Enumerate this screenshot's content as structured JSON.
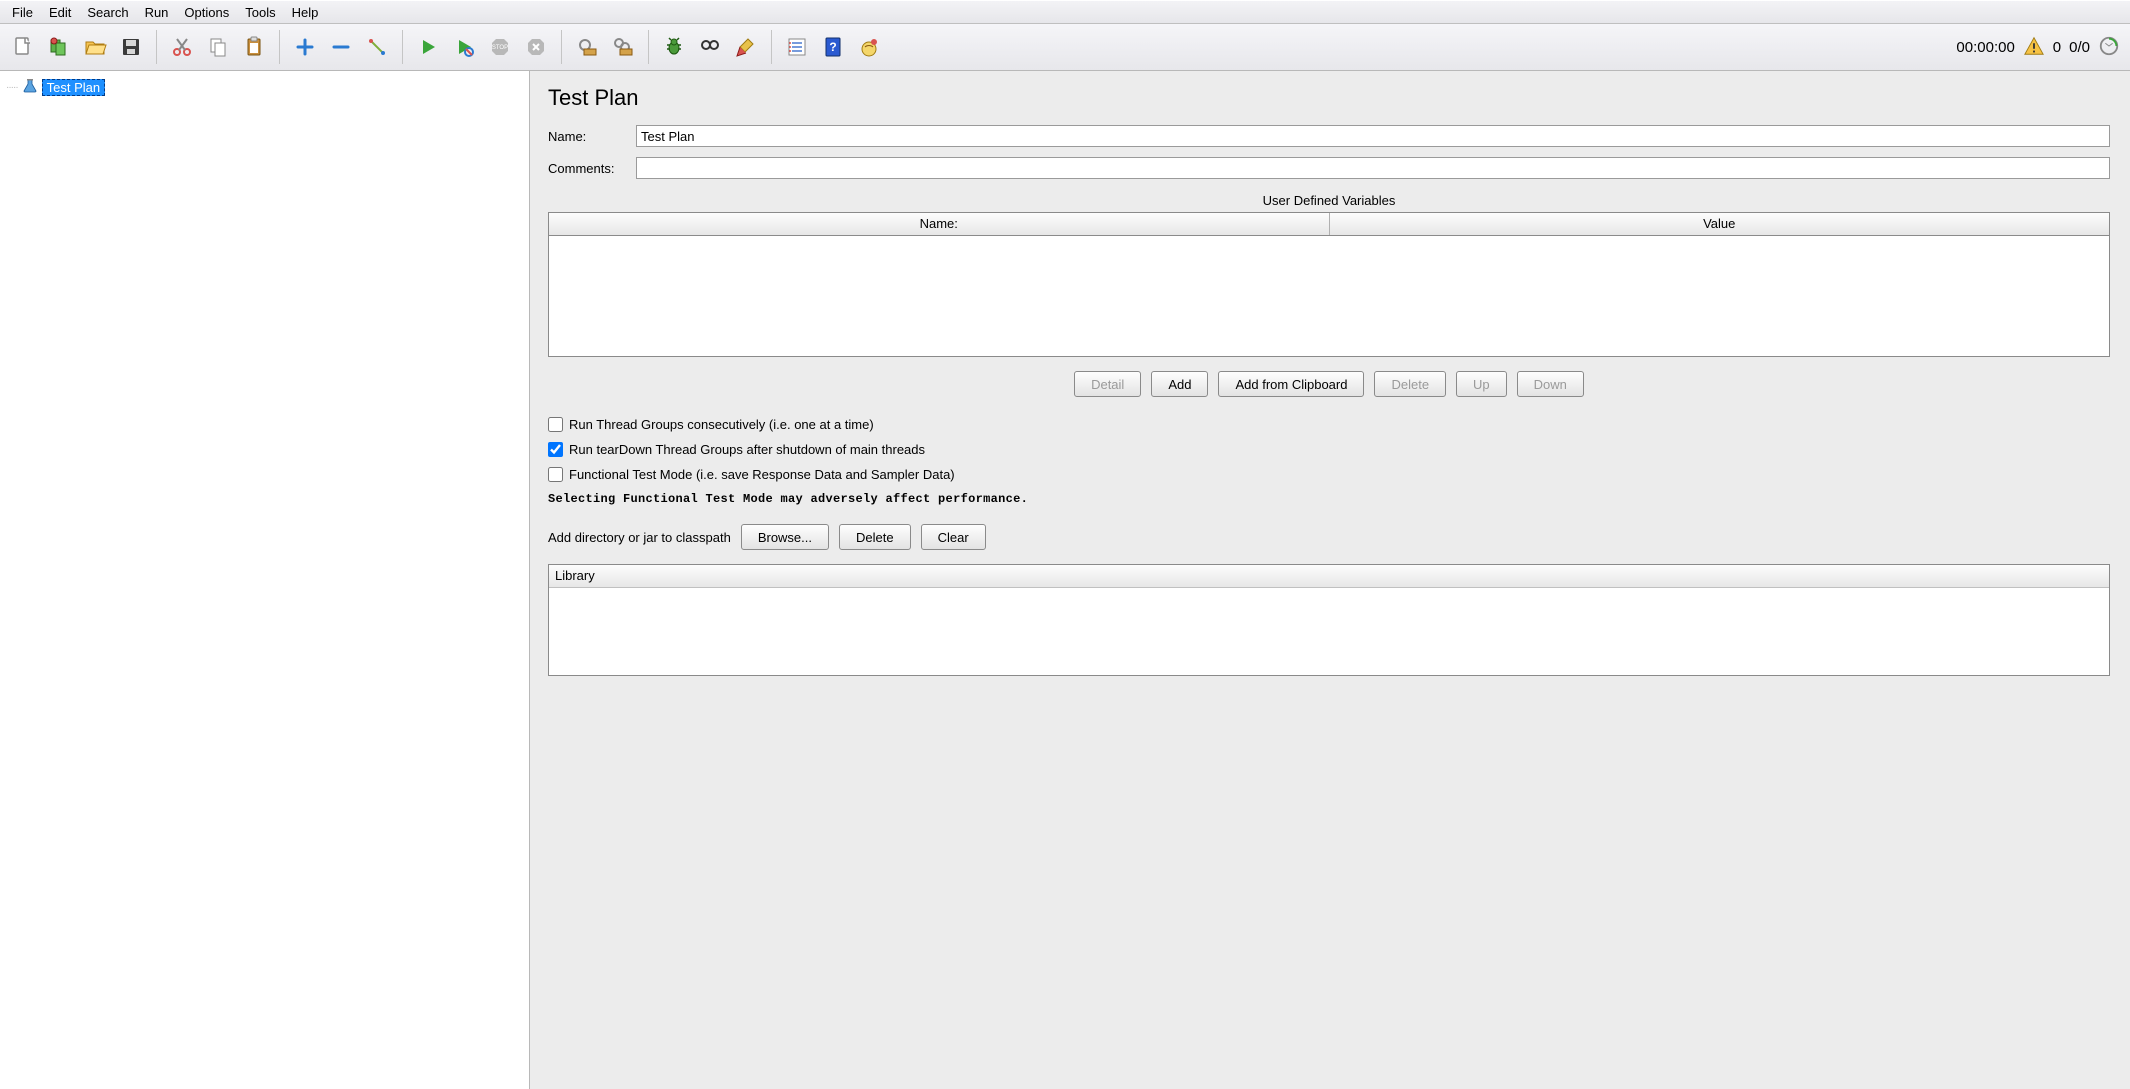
{
  "menu": {
    "file": "File",
    "edit": "Edit",
    "search": "Search",
    "run": "Run",
    "options": "Options",
    "tools": "Tools",
    "help": "Help"
  },
  "toolbar_icons": {
    "new": "new-file-icon",
    "templates": "templates-icon",
    "open": "open-icon",
    "save": "save-icon",
    "cut": "cut-icon",
    "copy": "copy-icon",
    "paste": "paste-icon",
    "expand": "plus-icon",
    "collapse": "minus-icon",
    "toggle": "toggle-icon",
    "start": "start-icon",
    "start_no_pause": "start-no-pause-icon",
    "stop": "stop-icon",
    "shutdown": "shutdown-icon",
    "clear": "clear-icon",
    "clear_all": "clear-all-icon",
    "debug": "debug-icon",
    "search_tool": "search-tool-icon",
    "broom": "broom-icon",
    "func_helper": "function-helper-icon",
    "help_doc": "help-icon",
    "whats_this": "whats-this-icon"
  },
  "status": {
    "elapsed": "00:00:00",
    "warnings": "0",
    "threads": "0/0"
  },
  "tree": {
    "root": "Test Plan"
  },
  "panel": {
    "title": "Test Plan",
    "name_label": "Name:",
    "name_value": "Test Plan",
    "comments_label": "Comments:",
    "comments_value": "",
    "vars_title": "User Defined Variables",
    "vars_col_name": "Name:",
    "vars_col_value": "Value",
    "btn_detail": "Detail",
    "btn_add": "Add",
    "btn_add_clip": "Add from Clipboard",
    "btn_delete": "Delete",
    "btn_up": "Up",
    "btn_down": "Down",
    "chk_consecutive": "Run Thread Groups consecutively (i.e. one at a time)",
    "chk_teardown": "Run tearDown Thread Groups after shutdown of main threads",
    "chk_functional": "Functional Test Mode (i.e. save Response Data and Sampler Data)",
    "perf_note": "Selecting Functional Test Mode may adversely affect performance.",
    "classpath_label": "Add directory or jar to classpath",
    "btn_browse": "Browse...",
    "btn_cp_delete": "Delete",
    "btn_clear": "Clear",
    "lib_header": "Library"
  }
}
